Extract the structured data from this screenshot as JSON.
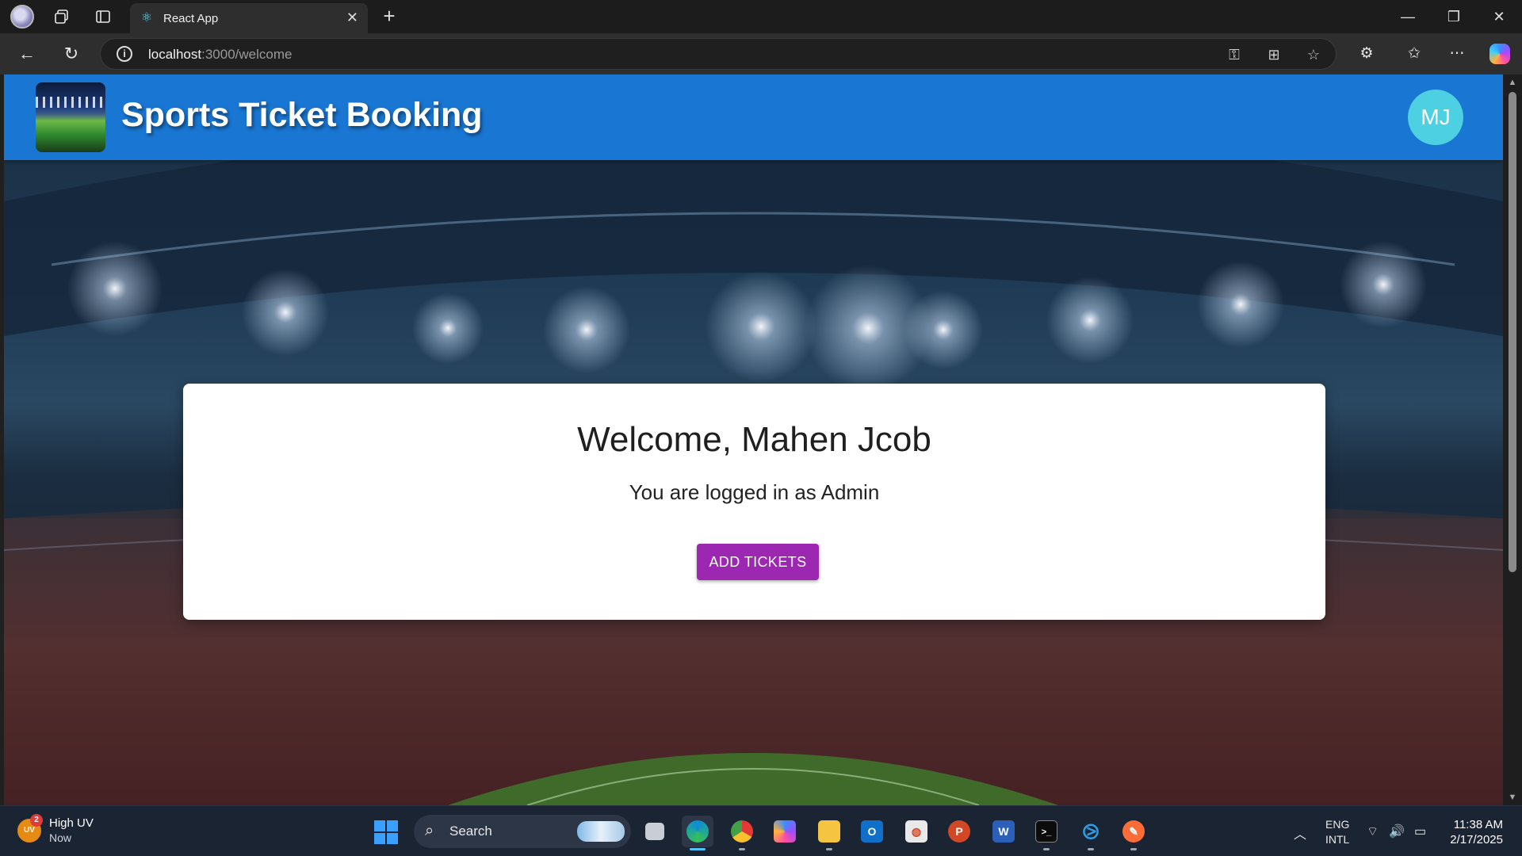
{
  "browser": {
    "tab_title": "React App",
    "url_host": "localhost",
    "url_path": ":3000/welcome",
    "new_tab_symbol": "+",
    "window_controls": {
      "minimize": "—",
      "restore": "❐",
      "close": "✕"
    }
  },
  "app": {
    "title": "Sports Ticket Booking",
    "avatar_initials": "MJ",
    "primary_color": "#1976d2",
    "avatar_color": "#4dd0e1",
    "button_color": "#9c27b0"
  },
  "welcome_card": {
    "heading": "Welcome, Mahen Jcob",
    "subtext": "You are logged in as Admin",
    "button_label": "ADD TICKETS"
  },
  "taskbar": {
    "weather_title": "High UV",
    "weather_sub": "Now",
    "weather_icon_text": "UV",
    "weather_badge": "2",
    "search_label": "Search",
    "apps": [
      "task-view",
      "edge",
      "chrome",
      "copilot",
      "file-explorer",
      "outlook",
      "office",
      "powerpoint",
      "word",
      "terminal",
      "vscode",
      "postman"
    ],
    "language_top": "ENG",
    "language_bottom": "INTL",
    "time": "11:38 AM",
    "date": "2/17/2025"
  }
}
